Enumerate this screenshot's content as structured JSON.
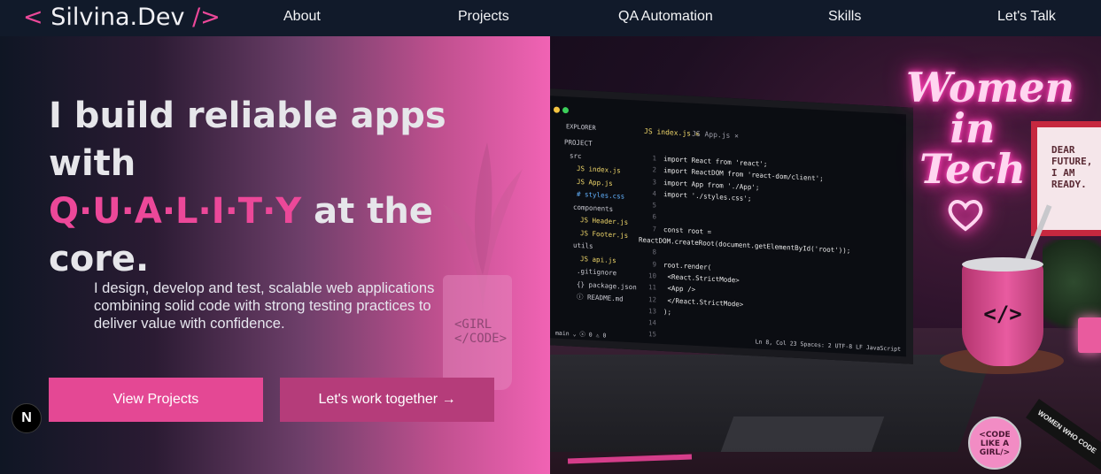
{
  "nav": {
    "logo_open": "<",
    "logo_text": "Silvina.Dev",
    "logo_close": "/>",
    "links": [
      "About",
      "Projects",
      "QA Automation",
      "Skills",
      "Let's Talk"
    ]
  },
  "hero": {
    "headline_1": "I build reliable apps with",
    "headline_quality": "Q·U·A·L·I·T·Y",
    "headline_2": "at the",
    "headline_3": "core.",
    "description": "I design, develop and test, scalable web applications combining solid code with strong testing practices to deliver value with confidence.",
    "primary_button": "View Projects",
    "secondary_button": "Let's work together →",
    "pot_text": "<GIRL\n</CODE>"
  },
  "image": {
    "neon_text": "Women in Tech",
    "frame_text": "DEAR\nFUTURE,\nI AM\nREADY.",
    "mug_icon": "</>",
    "keychain_text": "<CODE\nLIKE A\nGIRL/>",
    "strap_text": "WOMEN WHO CODE",
    "editor": {
      "explorer": "EXPLORER",
      "tabs": [
        "JS index.js  ×",
        "JS App.js  ×"
      ],
      "tree": [
        "PROJECT",
        "src",
        "JS index.js",
        "JS App.js",
        "# styles.css",
        "components",
        "JS Header.js",
        "JS Footer.js",
        "utils",
        "JS api.js",
        ".gitignore",
        "{} package.json",
        "ⓘ README.md"
      ],
      "code": [
        "import React from 'react';",
        "import ReactDOM from 'react-dom/client';",
        "import App from './App';",
        "import './styles.css';",
        "",
        "",
        "const root = ReactDOM.createRoot(document.getElementById('root'));",
        "",
        "root.render(",
        "  <React.StrictMode>",
        "    <App />",
        "  </React.StrictMode>",
        ");",
        "",
        ""
      ],
      "status_left": "main ⌄   ⓧ 0 ⚠ 0",
      "status_right": "Ln 8, Col 23   Spaces: 2   UTF-8   LF   JavaScript"
    }
  },
  "next_badge": "N",
  "colors": {
    "accent": "#ec4899",
    "nav_bg": "#111a2a",
    "button_primary": "#e44894",
    "button_secondary": "#b53c7a"
  }
}
